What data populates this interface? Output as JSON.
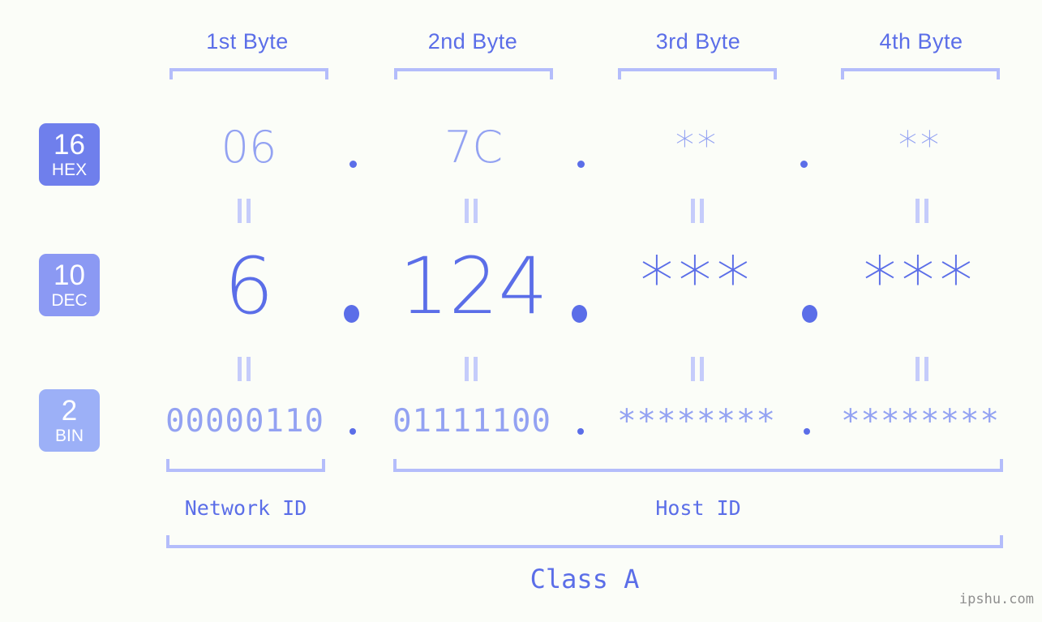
{
  "page": {
    "background_color": "#fbfdf8",
    "accent_color": "#5b6ee8",
    "accent_light_color": "#93a2f2",
    "bracket_color": "#b4bdfb",
    "watermark": "ipshu.com"
  },
  "byte_headers": [
    {
      "label": "1st Byte"
    },
    {
      "label": "2nd Byte"
    },
    {
      "label": "3rd Byte"
    },
    {
      "label": "4th Byte"
    }
  ],
  "rows": [
    {
      "badge": {
        "number": "16",
        "name": "HEX",
        "color": "#6f7fec"
      },
      "values": [
        "06",
        "7C",
        "**",
        "**"
      ],
      "separator": "."
    },
    {
      "badge": {
        "number": "10",
        "name": "DEC",
        "color": "#8b99f3"
      },
      "values": [
        "6",
        "124",
        "***",
        "***"
      ],
      "separator": "."
    },
    {
      "badge": {
        "number": "2",
        "name": "BIN",
        "color": "#9cb0f7"
      },
      "values": [
        "00000110",
        "01111100",
        "********",
        "********"
      ],
      "separator": "."
    }
  ],
  "equal_marks": {
    "symbol": "||",
    "count_per_gap": 4
  },
  "id_sections": [
    {
      "label": "Network ID"
    },
    {
      "label": "Host ID"
    }
  ],
  "class_section": {
    "label": "Class A"
  }
}
